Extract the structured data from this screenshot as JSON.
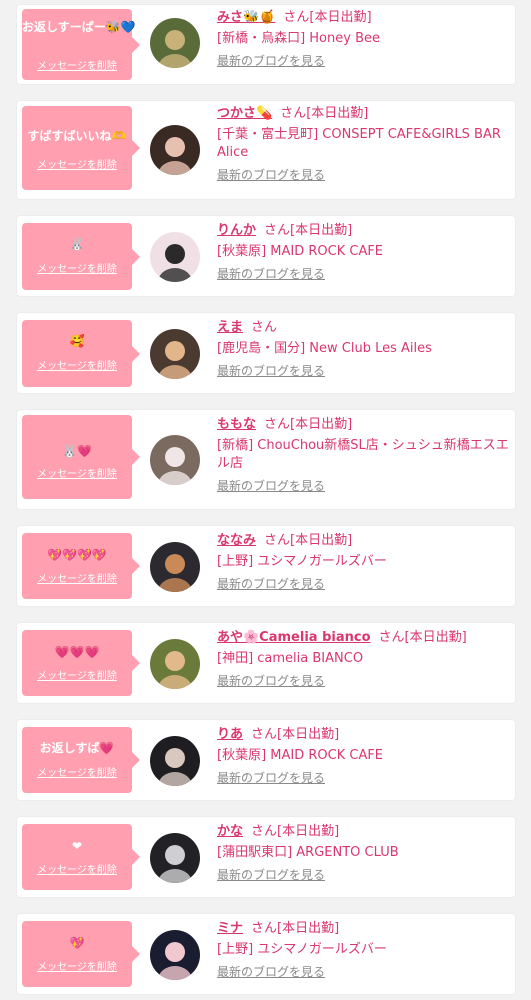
{
  "common": {
    "delete_label": "メッセージを削除",
    "san_label": "さん",
    "blog_label": "最新のブログを見る"
  },
  "cards": [
    {
      "message": "お返しすーぱー🐝💙",
      "name": "みさ🐝🍯",
      "status": "[本日出勤]",
      "shop": "[新橋・烏森口] Honey Bee",
      "avatar_colors": [
        "#5a6b3a",
        "#c9b27a"
      ]
    },
    {
      "message": "すばすばいいね🫶",
      "name": "つかさ💊",
      "status": "[本日出勤]",
      "shop": "[千葉・富士見町] CONSEPT CAFE&GIRLS BAR Alice",
      "avatar_colors": [
        "#3a2a24",
        "#e8c0b0"
      ]
    },
    {
      "message": "🐰",
      "name": "りんか",
      "status": "[本日出勤]",
      "shop": "[秋葉原] MAID ROCK CAFE",
      "avatar_colors": [
        "#f1dfe6",
        "#2a2a2a"
      ]
    },
    {
      "message": "🥰",
      "name": "えま",
      "status": "",
      "shop": "[鹿児島・国分] New Club Les Ailes",
      "avatar_colors": [
        "#4a3a30",
        "#e3b58a"
      ]
    },
    {
      "message": "🐰💗",
      "name": "ももな",
      "status": "[本日出勤]",
      "shop": "[新橋] ChouChou新橋SL店・シュシュ新橋エスエル店",
      "avatar_colors": [
        "#7a6a60",
        "#f0e6e6"
      ]
    },
    {
      "message": "💖💖💖💖",
      "name": "ななみ",
      "status": "[本日出勤]",
      "shop": "[上野] ユシマノガールズバー",
      "avatar_colors": [
        "#2c2a30",
        "#c98a58"
      ]
    },
    {
      "message": "💗💗💗",
      "name": "あや🌸Camelia bianco",
      "status": "[本日出勤]",
      "shop": "[神田] camelia BIANCO",
      "avatar_colors": [
        "#6a7a3a",
        "#e2b98a"
      ]
    },
    {
      "message": "お返しすば💗",
      "name": "りあ",
      "status": "[本日出勤]",
      "shop": "[秋葉原] MAID ROCK CAFE",
      "avatar_colors": [
        "#1e1e22",
        "#d8c8c0"
      ]
    },
    {
      "message": "❤",
      "name": "かな",
      "status": "[本日出勤]",
      "shop": "[蒲田駅東口] ARGENTO CLUB",
      "avatar_colors": [
        "#222226",
        "#cfcfd2"
      ]
    },
    {
      "message": "💖",
      "name": "ミナ",
      "status": "[本日出勤]",
      "shop": "[上野] ユシマノガールズバー",
      "avatar_colors": [
        "#1a1c30",
        "#f2c8d0"
      ]
    }
  ]
}
